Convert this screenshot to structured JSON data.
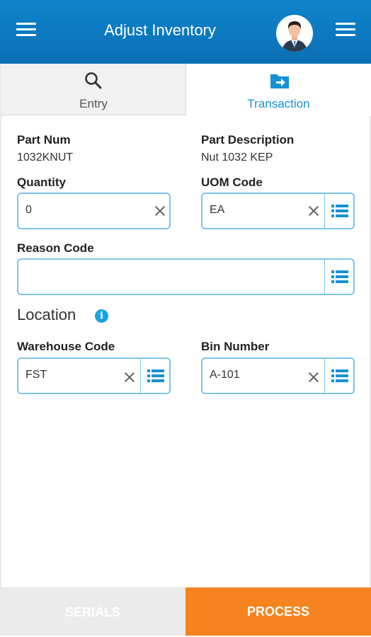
{
  "header": {
    "title": "Adjust Inventory",
    "left_menu_icon": "hamburger-menu-icon",
    "right_menu_icon": "hamburger-menu-icon",
    "avatar_icon": "user-avatar-icon",
    "background_color": "#0b78bf"
  },
  "tabs": [
    {
      "label": "Entry",
      "icon": "search-icon",
      "active": false
    },
    {
      "label": "Transaction",
      "icon": "folder-arrow-icon",
      "active": true
    }
  ],
  "form": {
    "part_num": {
      "label": "Part Num",
      "value": "1032KNUT"
    },
    "part_description": {
      "label": "Part Description",
      "value": "Nut 1032 KEP"
    },
    "quantity": {
      "label": "Quantity",
      "value": "0"
    },
    "uom_code": {
      "label": "UOM Code",
      "value": "EA"
    },
    "reason_code": {
      "label": "Reason Code",
      "value": ""
    }
  },
  "location": {
    "title": "Location",
    "info_icon": "info-icon",
    "info_glyph": "i",
    "warehouse_code": {
      "label": "Warehouse Code",
      "value": "FST"
    },
    "bin_number": {
      "label": "Bin Number",
      "value": "A-101"
    }
  },
  "footer": {
    "serials_label": "SERIALS",
    "process_label": "PROCESS",
    "process_color": "#f5841f",
    "accent_color": "#1591d4"
  }
}
